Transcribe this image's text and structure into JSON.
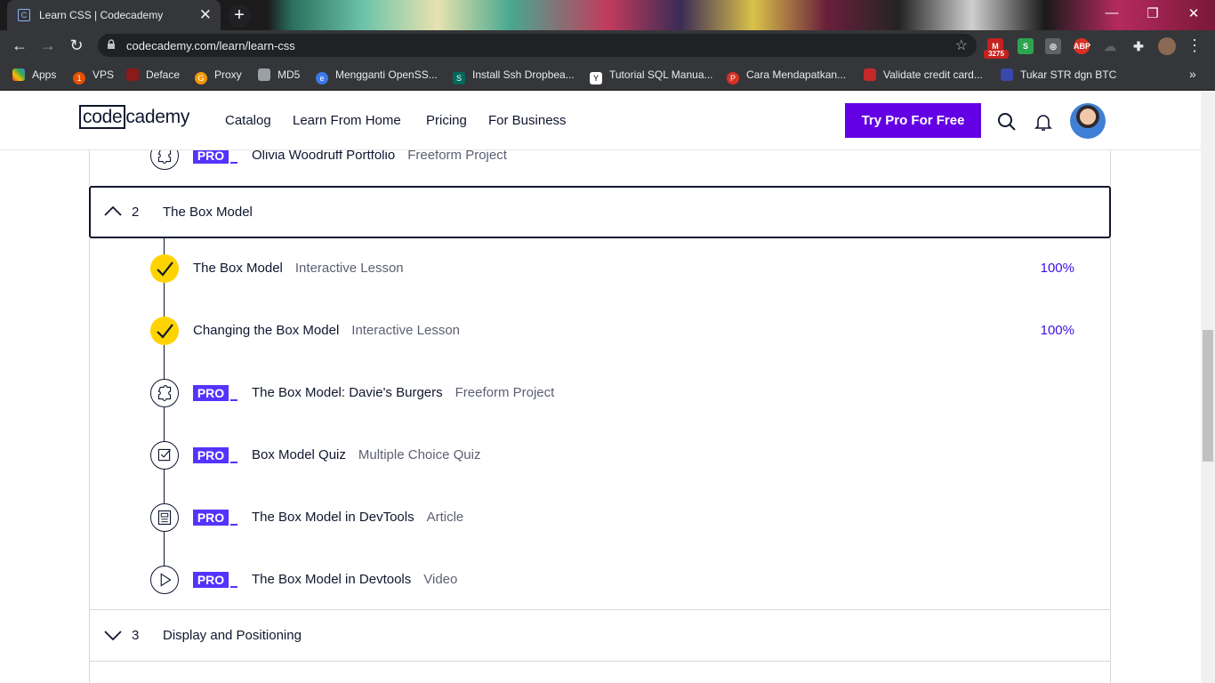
{
  "browser": {
    "tab_title": "Learn CSS | Codecademy",
    "url": "codecademy.com/learn/learn-css",
    "bookmarks": [
      "Apps",
      "VPS",
      "Deface",
      "Proxy",
      "MD5",
      "Mengganti OpenSS...",
      "Install Ssh Dropbea...",
      "Tutorial SQL Manua...",
      "Cara Mendapatkan...",
      "Validate credit card...",
      "Tukar STR dgn BTC"
    ],
    "gmail_badge": "3275",
    "more_bookmarks": "»"
  },
  "header": {
    "logo_code": "code",
    "logo_cademy": "cademy",
    "nav": [
      "Catalog",
      "Learn From Home",
      "Pricing",
      "For Business"
    ],
    "cta": "Try Pro For Free"
  },
  "syllabus": {
    "prev_item": {
      "title": "Olivia Woodruff Portfolio",
      "type": "Freeform Project",
      "pro": "PRO"
    },
    "section2": {
      "number": "2",
      "title": "The Box Model"
    },
    "items": [
      {
        "title": "The Box Model",
        "type": "Interactive Lesson",
        "progress": "100%",
        "pro": ""
      },
      {
        "title": "Changing the Box Model",
        "type": "Interactive Lesson",
        "progress": "100%",
        "pro": ""
      },
      {
        "title": "The Box Model: Davie's Burgers",
        "type": "Freeform Project",
        "progress": "",
        "pro": "PRO"
      },
      {
        "title": "Box Model Quiz",
        "type": "Multiple Choice Quiz",
        "progress": "",
        "pro": "PRO"
      },
      {
        "title": "The Box Model in DevTools",
        "type": "Article",
        "progress": "",
        "pro": "PRO"
      },
      {
        "title": "The Box Model in Devtools",
        "type": "Video",
        "progress": "",
        "pro": "PRO"
      }
    ],
    "section3": {
      "number": "3",
      "title": "Display and Positioning"
    }
  }
}
